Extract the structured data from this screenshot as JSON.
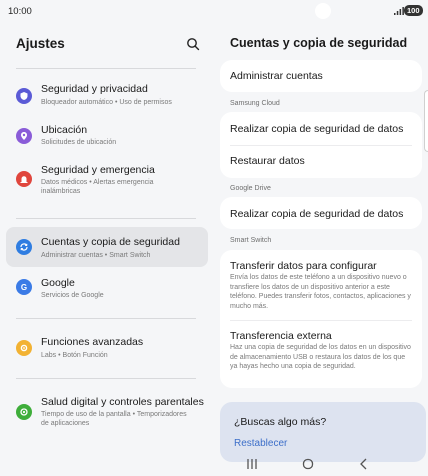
{
  "status": {
    "time": "10:00",
    "battery": "100"
  },
  "left": {
    "title": "Ajustes",
    "items": [
      {
        "label": "Seguridad y privacidad",
        "sub": "Bloqueador automático • Uso de permisos",
        "color": "#5b5bd6"
      },
      {
        "label": "Ubicación",
        "sub": "Solicitudes de ubicación",
        "color": "#8a5cd8"
      },
      {
        "label": "Seguridad y emergencia",
        "sub": "Datos médicos • Alertas emergencia inalámbricas",
        "color": "#e0463d"
      },
      {
        "label": "Cuentas y copia de seguridad",
        "sub": "Administrar cuentas • Smart Switch",
        "color": "#2f7de1"
      },
      {
        "label": "Google",
        "sub": "Servicios de Google",
        "color": "#3b7be6"
      },
      {
        "label": "Funciones avanzadas",
        "sub": "Labs • Botón Función",
        "color": "#f2b233"
      },
      {
        "label": "Salud digital y controles parentales",
        "sub": "Tiempo de uso de la pantalla • Temporizadores de aplicaciones",
        "color": "#3fae3b"
      }
    ]
  },
  "right": {
    "title": "Cuentas y copia de seguridad",
    "manage_accounts": "Administrar cuentas",
    "samsung_cloud": {
      "header": "Samsung Cloud",
      "backup": "Realizar copia de seguridad de datos",
      "restore": "Restaurar datos"
    },
    "google_drive": {
      "header": "Google Drive",
      "backup": "Realizar copia de seguridad de datos"
    },
    "smart_switch": {
      "header": "Smart Switch",
      "transfer_title": "Transferir datos para configurar",
      "transfer_desc": "Envía los datos de este teléfono a un dispositivo nuevo o transfiere los datos de un dispositivo anterior a este teléfono. Puedes transferir fotos, contactos, aplicaciones y mucho más.",
      "external_title": "Transferencia externa",
      "external_desc": "Haz una copia de seguridad de los datos en un dispositivo de almacenamiento USB o restaura los datos de los que ya hayas hecho una copia de seguridad."
    },
    "help": {
      "question": "¿Buscas algo más?",
      "link": "Restablecer"
    }
  }
}
